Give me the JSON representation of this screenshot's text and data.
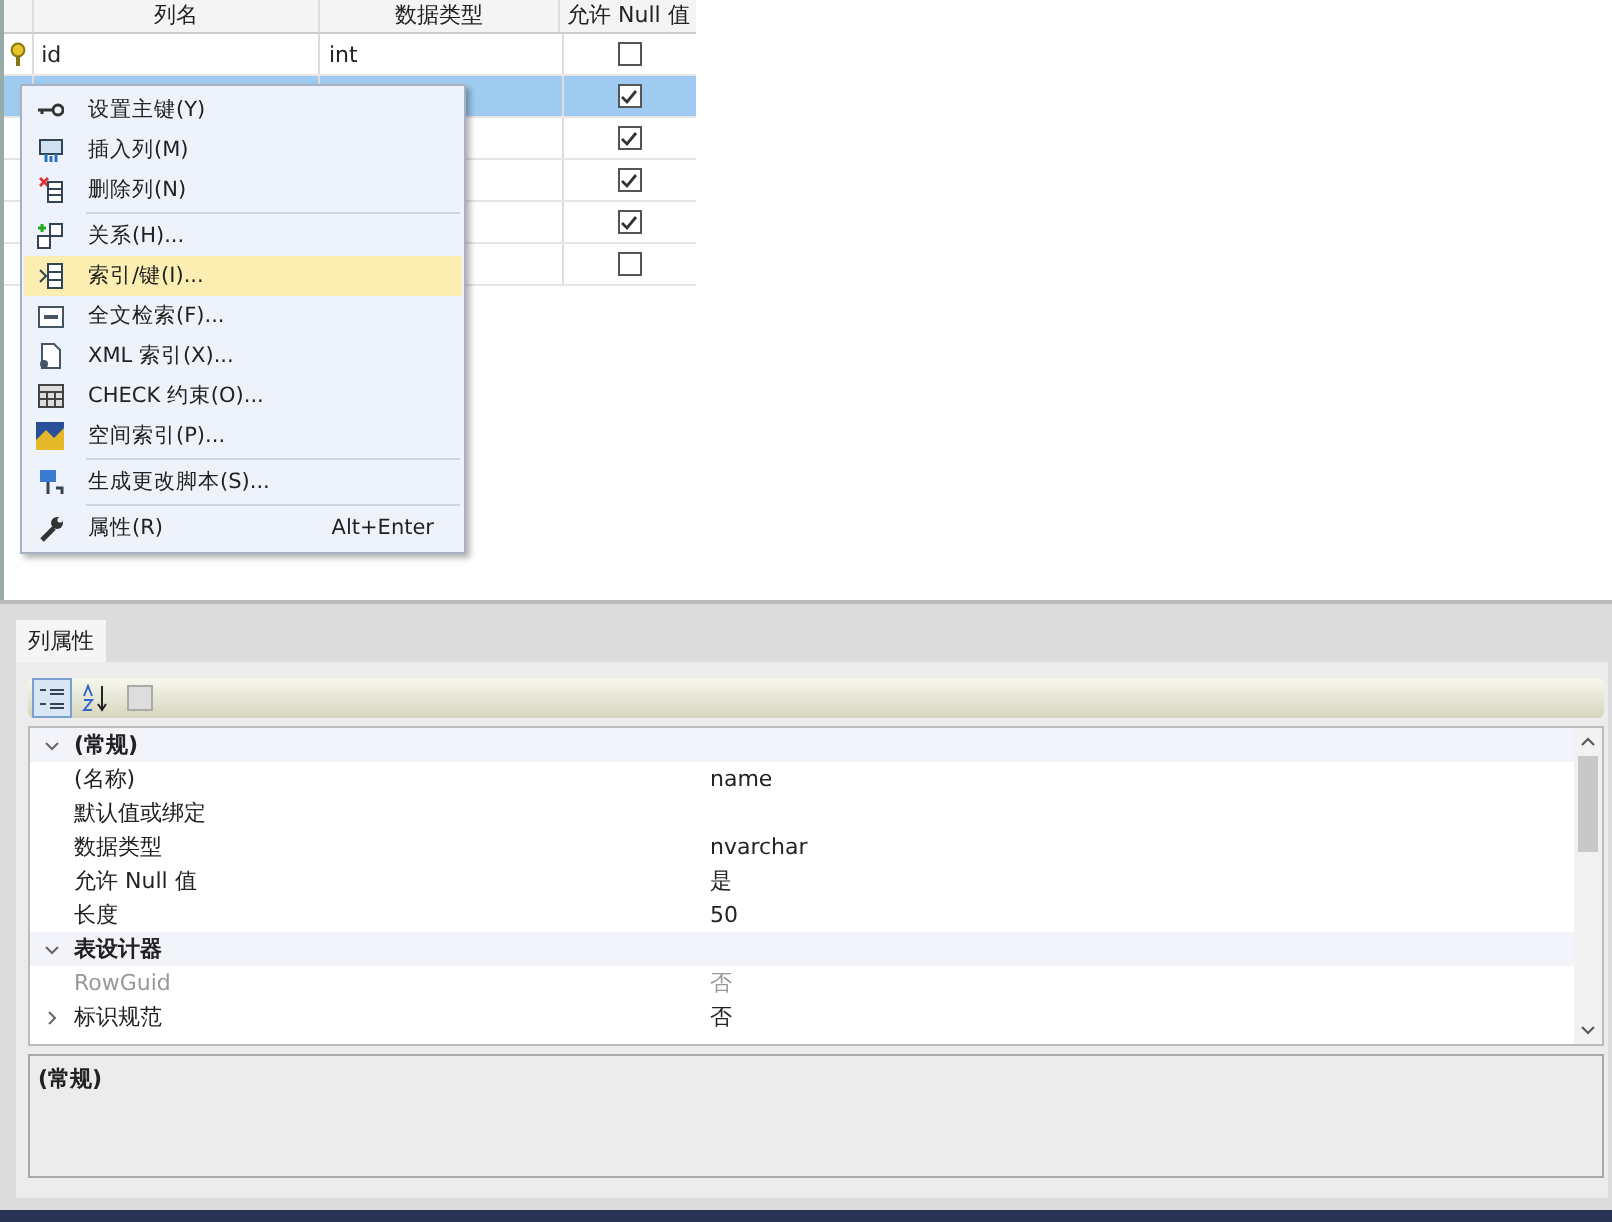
{
  "grid": {
    "columns": [
      "列名",
      "数据类型",
      "允许 Null 值"
    ],
    "rows": [
      {
        "name": "id",
        "type": "int",
        "allow_null": false,
        "primary_key": true,
        "selected": false
      },
      {
        "allow_null": true,
        "primary_key": false,
        "selected": true
      },
      {
        "allow_null": true,
        "primary_key": false,
        "selected": false
      },
      {
        "allow_null": true,
        "primary_key": false,
        "selected": false
      },
      {
        "allow_null": true,
        "primary_key": false,
        "selected": false
      },
      {
        "allow_null": false,
        "primary_key": false,
        "selected": false
      }
    ]
  },
  "context_menu": {
    "items": [
      {
        "kind": "item",
        "label": "设置主键(Y)",
        "selected": false
      },
      {
        "kind": "item",
        "label": "插入列(M)",
        "selected": false
      },
      {
        "kind": "item",
        "label": "删除列(N)",
        "selected": false
      },
      {
        "kind": "separator"
      },
      {
        "kind": "item",
        "label": "关系(H)...",
        "selected": false
      },
      {
        "kind": "item",
        "label": "索引/键(I)...",
        "selected": true
      },
      {
        "kind": "item",
        "label": "全文检索(F)...",
        "selected": false
      },
      {
        "kind": "item",
        "label": "XML 索引(X)...",
        "selected": false
      },
      {
        "kind": "item",
        "label": "CHECK 约束(O)...",
        "selected": false
      },
      {
        "kind": "item",
        "label": "空间索引(P)...",
        "selected": false
      },
      {
        "kind": "separator"
      },
      {
        "kind": "item",
        "label": "生成更改脚本(S)...",
        "selected": false
      },
      {
        "kind": "separator"
      },
      {
        "kind": "item",
        "label": "属性(R)",
        "shortcut": "Alt+Enter",
        "selected": false
      }
    ]
  },
  "properties_panel": {
    "tab": "列属性",
    "toolbar": [
      {
        "selected": true
      },
      {
        "selected": false
      },
      {
        "selected": false
      }
    ],
    "rows": [
      {
        "kind": "category",
        "label": "(常规)",
        "expanded": true
      },
      {
        "kind": "property",
        "label": "(名称)",
        "value": "name",
        "disabled": false
      },
      {
        "kind": "property",
        "label": "默认值或绑定",
        "disabled": false
      },
      {
        "kind": "property",
        "label": "数据类型",
        "value": "nvarchar",
        "disabled": false
      },
      {
        "kind": "property",
        "label": "允许 Null 值",
        "value": "是",
        "disabled": false
      },
      {
        "kind": "property",
        "label": "长度",
        "value": "50",
        "disabled": false
      },
      {
        "kind": "category",
        "label": "表设计器",
        "expanded": true
      },
      {
        "kind": "property",
        "label": "RowGuid",
        "value": "否",
        "disabled": true
      },
      {
        "kind": "group",
        "label": "标识规范",
        "value": "否",
        "expanded": false,
        "disabled": false
      }
    ],
    "description": "(常规)"
  }
}
